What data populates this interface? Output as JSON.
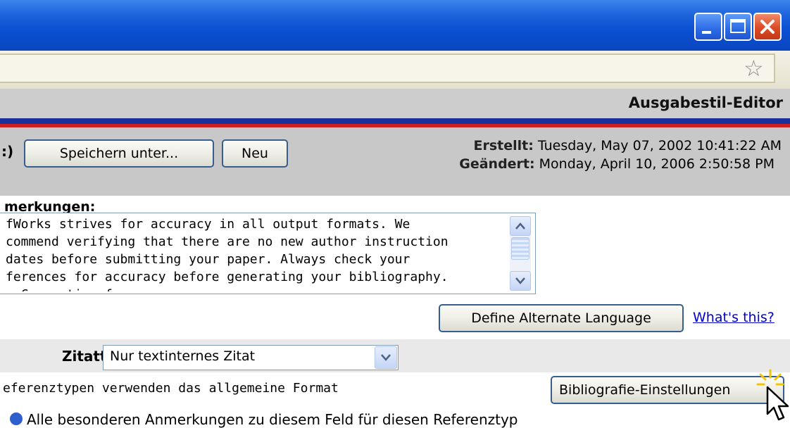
{
  "window": {
    "minimize_icon": "minimize-icon",
    "maximize_icon": "maximize-icon",
    "close_icon": "close-icon"
  },
  "address_bar": {
    "bookmark_icon": "star-icon"
  },
  "header": {
    "title": "Ausgabestil-Editor"
  },
  "toolbar": {
    "paren_text": ":)",
    "save_as_label": "Speichern unter...",
    "new_label": "Neu",
    "created_label": "Erstellt:",
    "created_value": " Tuesday, May 07, 2002 10:41:22 AM",
    "modified_label": "Geändert:",
    "modified_value": " Monday, April 10, 2006 2:50:58 PM"
  },
  "notes": {
    "label": "merkungen:",
    "text": "fWorks strives for accuracy in all output formats. We\ncommend verifying that there are no new author instruction\ndates before submitting your paper. Always check your\nferences for accuracy before generating your bibliography.\n  Converting from...",
    "alternate_language_label": "Define Alternate Language",
    "whats_this_label": "What's this?"
  },
  "citation": {
    "label": "Zitattyp:",
    "selected": "Nur textinternes Zitat"
  },
  "reference_types": {
    "text": "eferenztypen verwenden das allgemeine Format",
    "bibliography_settings_label": "Bibliografie-Einstellungen"
  },
  "bottom": {
    "text": "Alle besonderen Anmerkungen zu diesem Feld für diesen Referenztyp"
  },
  "colors": {
    "titlebar": "#0b4fd3",
    "stripe_blue": "#1b2f9c",
    "stripe_red": "#cc2020",
    "link": "#0000cc"
  }
}
